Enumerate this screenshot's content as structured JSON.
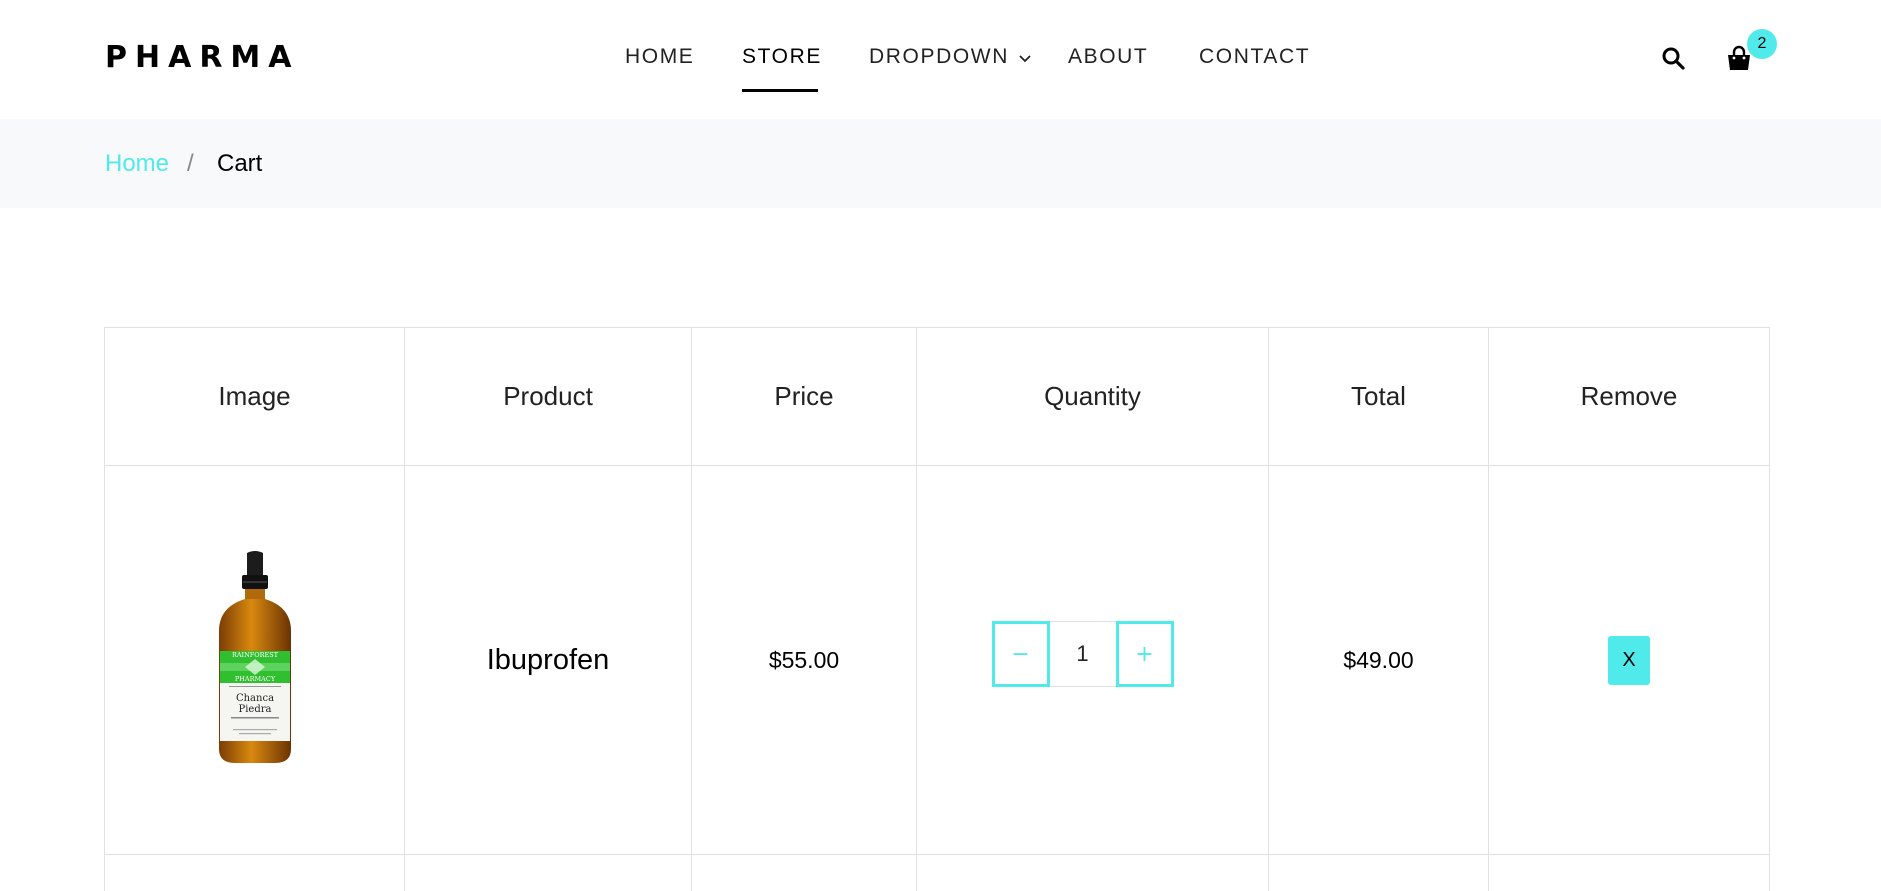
{
  "header": {
    "logo": "PHARMA",
    "nav": [
      {
        "label": "HOME"
      },
      {
        "label": "STORE",
        "active": true
      },
      {
        "label": "DROPDOWN"
      },
      {
        "label": "ABOUT"
      },
      {
        "label": "CONTACT"
      }
    ],
    "cart_count": "2",
    "icons": [
      "search-icon",
      "shopping-bag-icon",
      "chevron-down-icon"
    ]
  },
  "breadcrumb": {
    "home": "Home",
    "separator": "/",
    "current": "Cart"
  },
  "table": {
    "columns": [
      "Image",
      "Product",
      "Price",
      "Quantity",
      "Total",
      "Remove"
    ],
    "rows": [
      {
        "product": "Ibuprofen",
        "price": "$55.00",
        "quantity_minus": "−",
        "quantity": "1",
        "quantity_plus": "+",
        "total": "$49.00",
        "remove": "X",
        "image_label": {
          "brand_top": "RAINFOREST",
          "brand_bottom": "PHARMACY",
          "name_line1": "Chanca",
          "name_line2": "Piedra"
        }
      }
    ]
  },
  "colors": {
    "accent": "#51eaea",
    "breadcrumb_bg": "#f8f9fa",
    "border": "#dee2e6"
  }
}
